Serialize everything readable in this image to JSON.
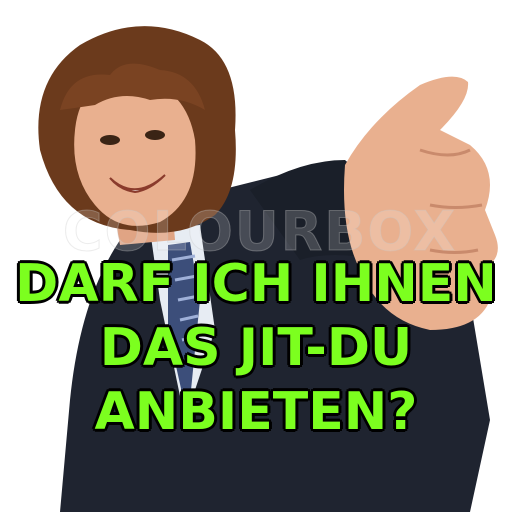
{
  "meme": {
    "caption_lines": [
      "DARF ICH IHNEN",
      "DAS JIT-DU",
      "ANBIETEN?"
    ],
    "caption_color": "#7cff1f",
    "watermark_text": "COLOURBOX"
  },
  "photo": {
    "subject": "smiling young man with curly hair in a dark suit, reaching out his hand",
    "suit_color": "#1f2430",
    "hair_color": "#6b3a1c",
    "skin_color": "#e9b08f"
  }
}
